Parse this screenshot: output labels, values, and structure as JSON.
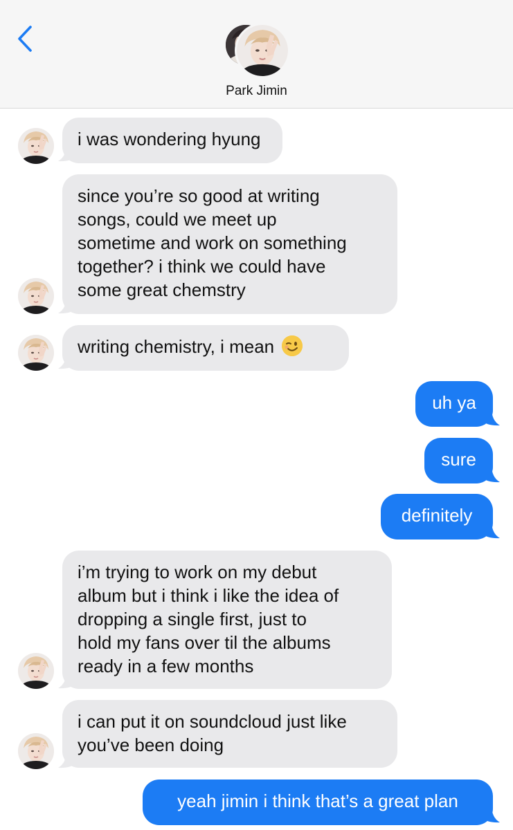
{
  "header": {
    "contact_name": "Park Jimin",
    "back_icon": "chevron-left-icon",
    "accent": "#1c7cf4"
  },
  "messages": [
    {
      "from": "incoming",
      "text": "i was wondering hyung"
    },
    {
      "from": "incoming",
      "text": "since you’re so good at writing\nsongs, could we meet up\nsometime and work on something\ntogether? i think we could have\nsome great chemstry"
    },
    {
      "from": "incoming",
      "text": "writing chemistry, i mean",
      "emoji": "winking-face-emoji"
    },
    {
      "from": "outgoing",
      "text": "uh ya"
    },
    {
      "from": "outgoing",
      "text": "sure"
    },
    {
      "from": "outgoing",
      "text": "definitely"
    },
    {
      "from": "incoming",
      "text": "i’m trying to work on my debut\nalbum but i think i like the idea of\ndropping a single first, just to\nhold my fans over til the albums\nready in a few months"
    },
    {
      "from": "incoming",
      "text": "i can put it on soundcloud just like\nyou’ve been doing"
    },
    {
      "from": "outgoing",
      "text": "yeah jimin i think that’s a great plan"
    }
  ],
  "colors": {
    "incoming_bubble": "#e9e9eb",
    "outgoing_bubble": "#1c7cf4",
    "header_bg": "#f6f6f6"
  }
}
